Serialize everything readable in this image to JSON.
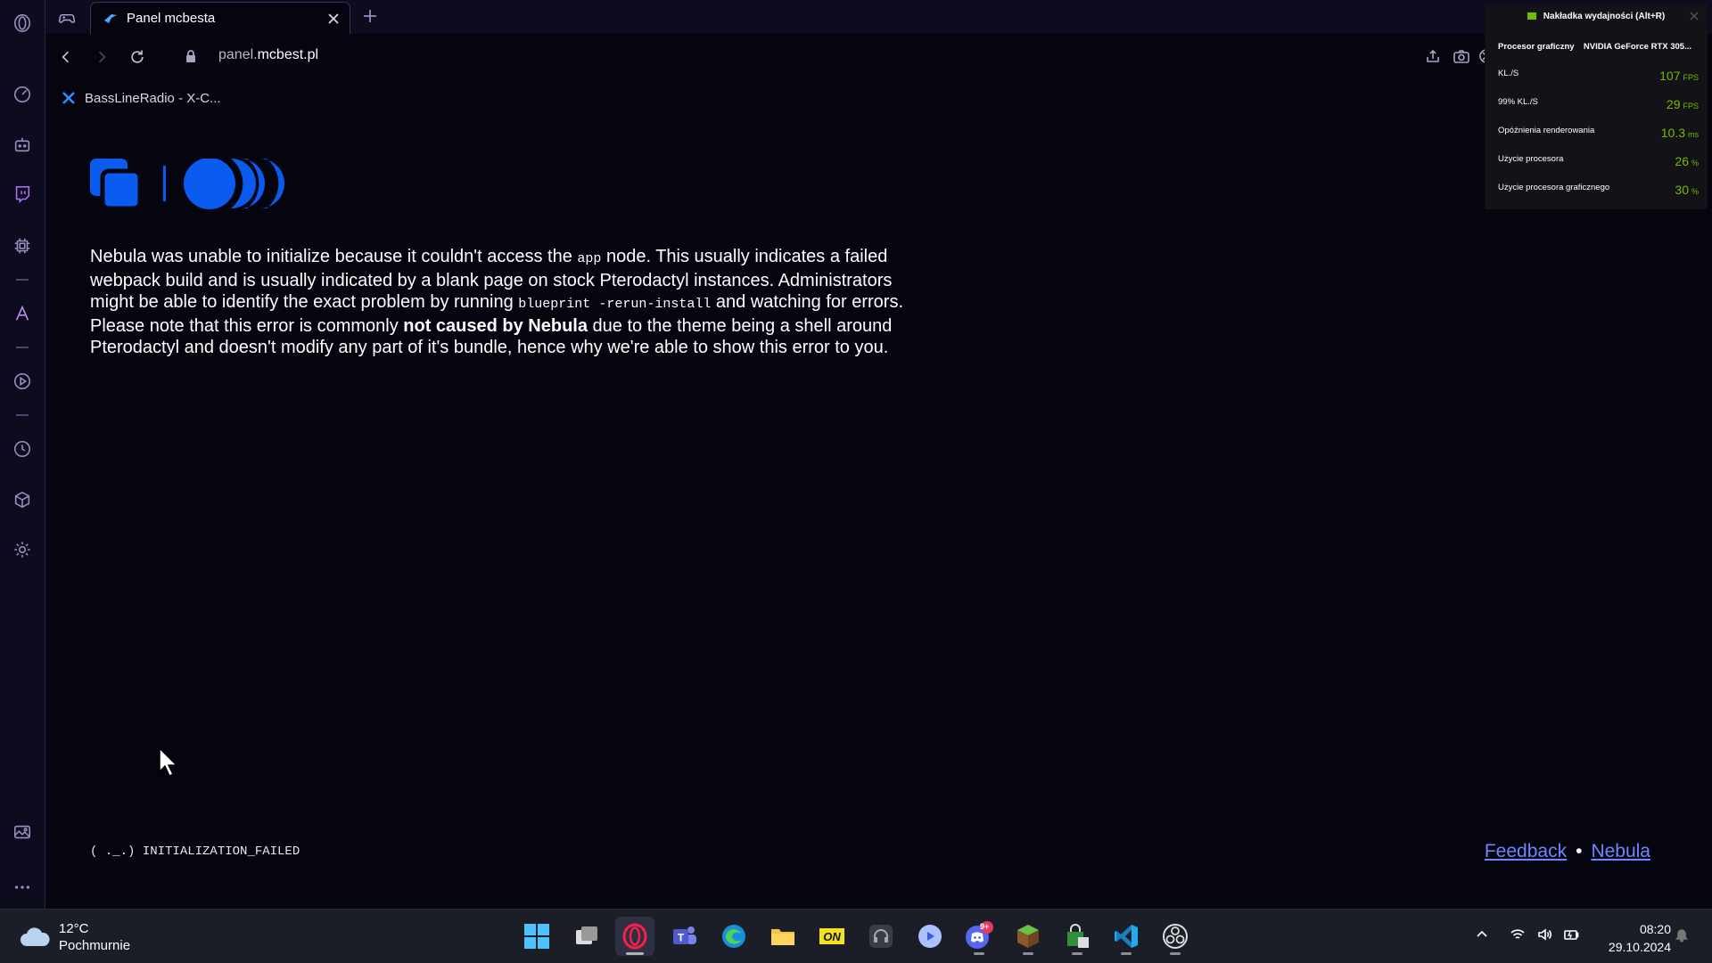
{
  "browser": {
    "tab_title": "Panel mcbesta",
    "url_prefix": "panel.",
    "url_domain": "mcbest.pl",
    "bookmark_label": "BassLineRadio - X-C..."
  },
  "page": {
    "para1_a": "Nebula was unable to initialize because it couldn't access the ",
    "para1_code1": "app",
    "para1_b": " node. This usually indicates a failed webpack build and is usually indicated by a blank page on stock Pterodactyl instances. Administrators might be able to identify the exact problem by running ",
    "para1_code2": "blueprint -rerun-install",
    "para1_c": " and watching for errors.",
    "para2_a": "Please note that this error is commonly ",
    "para2_bold": "not caused by Nebula",
    "para2_b": " due to the theme being a shell around Pterodactyl and doesn't modify any part of it's bundle, hence why we're able to show this error to you.",
    "status": "( ._.) INITIALIZATION_FAILED",
    "footer_feedback": "Feedback",
    "footer_dot": "•",
    "footer_nebula": "Nebula"
  },
  "overlay": {
    "title": "Nakładka wydajności (Alt+R)",
    "gpu_label": "Procesor graficzny",
    "gpu_value": "NVIDIA GeForce RTX 305...",
    "rows": [
      {
        "label": "KL./S",
        "value": "107",
        "unit": "FPS"
      },
      {
        "label": "99% KL./S",
        "value": "29",
        "unit": "FPS"
      },
      {
        "label": "Opóźnienia renderowania",
        "value": "10.3",
        "unit": "ms"
      },
      {
        "label": "Użycie procesora",
        "value": "26",
        "unit": "%"
      },
      {
        "label": "Użycie procesora graficznego",
        "value": "30",
        "unit": "%"
      }
    ],
    "accent": "#76b900"
  },
  "taskbar": {
    "temperature": "12°C",
    "weather": "Pochmurnie",
    "time": "08:20",
    "date": "29.10.2024",
    "discord_badge": "9+"
  },
  "colors": {
    "accent_link": "#6f86ff",
    "logo_blue": "#0a5bf0",
    "background": "#05050f"
  }
}
